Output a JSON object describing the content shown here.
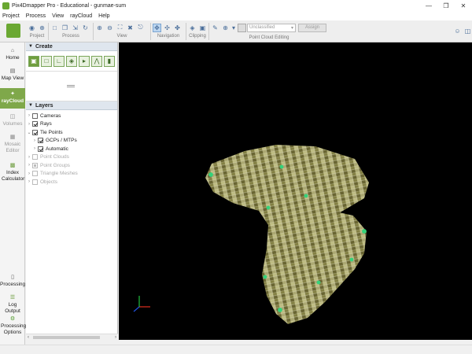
{
  "window": {
    "title": "Pix4Dmapper Pro - Educational - gunmae-sum",
    "minimize": "—",
    "restore": "❐",
    "close": "✕"
  },
  "menu": [
    "Project",
    "Process",
    "View",
    "rayCloud",
    "Help"
  ],
  "toolbar": {
    "groups": {
      "project": "Project",
      "process": "Process",
      "view": "View",
      "navigation": "Navigation",
      "clipping": "Clipping",
      "point_cloud_editing": "Point Cloud Editing"
    },
    "class_select": {
      "value": "Unclassified",
      "arrow": "▾"
    },
    "assign_label": "Assign"
  },
  "leftnav": {
    "items": [
      {
        "label": "Home",
        "icon": "home-icon",
        "state": "enabled"
      },
      {
        "label": "Map View",
        "icon": "map-icon",
        "state": "enabled"
      },
      {
        "label": "rayCloud",
        "icon": "raycloud-icon",
        "state": "selected"
      },
      {
        "label": "Volumes",
        "icon": "volumes-icon",
        "state": "disabled"
      },
      {
        "label": "Mosaic Editor",
        "icon": "mosaic-icon",
        "state": "disabled"
      },
      {
        "label": "Index Calculator",
        "icon": "index-calculator-icon",
        "state": "enabled"
      },
      {
        "label": "Processing",
        "icon": "processing-icon",
        "state": "enabled"
      },
      {
        "label": "Log Output",
        "icon": "log-output-icon",
        "state": "enabled"
      },
      {
        "label": "Processing Options",
        "icon": "gear-icon",
        "state": "enabled"
      }
    ]
  },
  "create_panel": {
    "title": "Create"
  },
  "layers_panel": {
    "title": "Layers",
    "items": [
      {
        "label": "Cameras",
        "level": 0,
        "checked": false,
        "disabled": false
      },
      {
        "label": "Rays",
        "level": 0,
        "checked": true,
        "disabled": false
      },
      {
        "label": "Tie Points",
        "level": 0,
        "checked": true,
        "disabled": false
      },
      {
        "label": "GCPs / MTPs",
        "level": 1,
        "checked": true,
        "disabled": false
      },
      {
        "label": "Automatic",
        "level": 1,
        "checked": true,
        "disabled": false
      },
      {
        "label": "Point Clouds",
        "level": 0,
        "checked": false,
        "disabled": true
      },
      {
        "label": "Point Groups",
        "level": 0,
        "checked": false,
        "disabled": true
      },
      {
        "label": "Triangle Meshes",
        "level": 0,
        "checked": false,
        "disabled": true
      },
      {
        "label": "Objects",
        "level": 0,
        "checked": false,
        "disabled": true
      }
    ]
  },
  "colors": {
    "accent_green": "#7fa84a",
    "viewport_bg": "#000000",
    "field_light": "#c8c68a",
    "field_dark": "#6e6a35",
    "camera_green": "#34d27a",
    "axis_x": "#e03020",
    "axis_y": "#20c040",
    "axis_z": "#2050e0"
  }
}
